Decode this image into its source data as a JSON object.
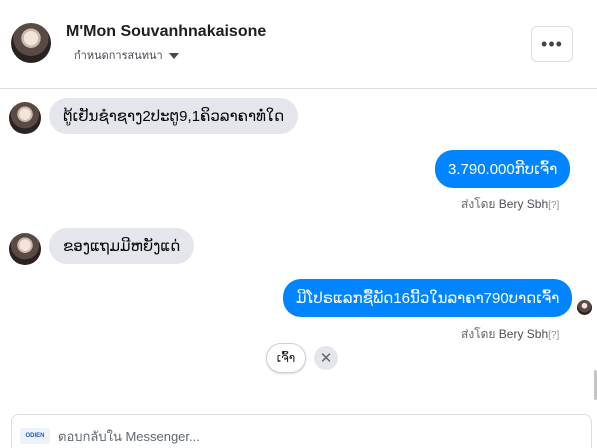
{
  "header": {
    "name": "M'Mon Souvanhnakaisone",
    "subtitle": "กำหนดการสนทนา",
    "more_label": "•••"
  },
  "messages": [
    {
      "direction": "incoming",
      "text": "ຕູ້ເຢັນຊຳຊາງ2ປະຕູ9,1ຄິວລາຄາທໍ່ໃດ"
    },
    {
      "direction": "outgoing",
      "text": "3.790.000ກີບເຈົ້າ",
      "sent_by_prefix": "ส่งโดย",
      "sent_by_name": "Bery Sbh",
      "sent_by_q": "[?]"
    },
    {
      "direction": "incoming",
      "text": "ຂອງແຖມມີຫຍັງແດ່"
    },
    {
      "direction": "outgoing",
      "text": "ມີໂປຣແລກຊື້ພັດ16ນີ້ວໃນລາຄາ790ບາດເຈົ້າ",
      "sent_by_prefix": "ส่งโดย",
      "sent_by_name": "Bery Sbh",
      "sent_by_q": "[?]"
    }
  ],
  "quick_reply": {
    "label": "ເຈົ້າ",
    "dismiss": "✕"
  },
  "composer": {
    "placeholder": "ตอบกลับใน Messenger...",
    "value": "",
    "logo_text": "ODIEN"
  },
  "colors": {
    "outgoing_bubble": "#0084ff",
    "incoming_bubble": "#e4e6eb"
  }
}
